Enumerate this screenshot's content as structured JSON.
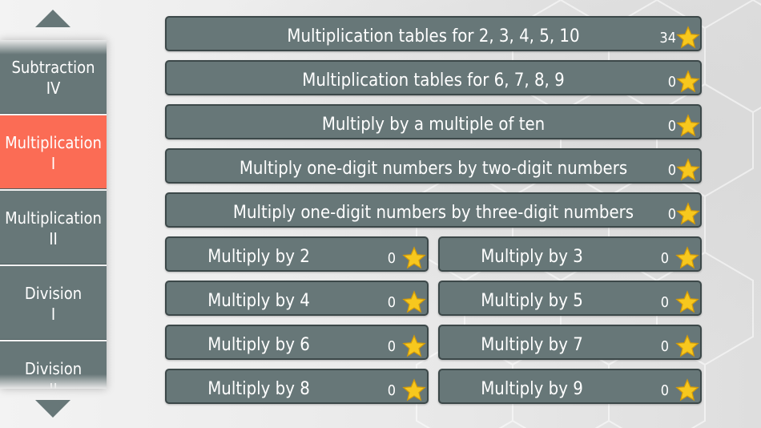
{
  "sidebar": {
    "items": [
      {
        "label": "Subtraction\nIV",
        "active": false
      },
      {
        "label": "Multiplication\nI",
        "active": true
      },
      {
        "label": "Multiplication\nII",
        "active": false
      },
      {
        "label": "Division\nI",
        "active": false
      },
      {
        "label": "Division\nII",
        "active": false
      }
    ]
  },
  "tiles": [
    {
      "label": "Multiplication tables for 2, 3, 4, 5, 10",
      "count": "34"
    },
    {
      "label": "Multiplication tables for 6, 7, 8, 9",
      "count": "0"
    },
    {
      "label": "Multiply by a multiple of ten",
      "count": "0"
    },
    {
      "label": "Multiply one-digit numbers by two-digit numbers",
      "count": "0"
    },
    {
      "label": "Multiply one-digit numbers by three-digit numbers",
      "count": "0"
    },
    {
      "label": "Multiply by 2",
      "count": "0"
    },
    {
      "label": "Multiply by 3",
      "count": "0"
    },
    {
      "label": "Multiply by 4",
      "count": "0"
    },
    {
      "label": "Multiply by 5",
      "count": "0"
    },
    {
      "label": "Multiply by 6",
      "count": "0"
    },
    {
      "label": "Multiply by 7",
      "count": "0"
    },
    {
      "label": "Multiply by 8",
      "count": "0"
    },
    {
      "label": "Multiply by 9",
      "count": "0"
    }
  ],
  "icons": {
    "scroll_up": "triangle-up-icon",
    "scroll_down": "triangle-down-icon",
    "star": "star-icon"
  },
  "colors": {
    "tile": "#677778",
    "active": "#fb6c55",
    "star": "#f7c81e"
  }
}
